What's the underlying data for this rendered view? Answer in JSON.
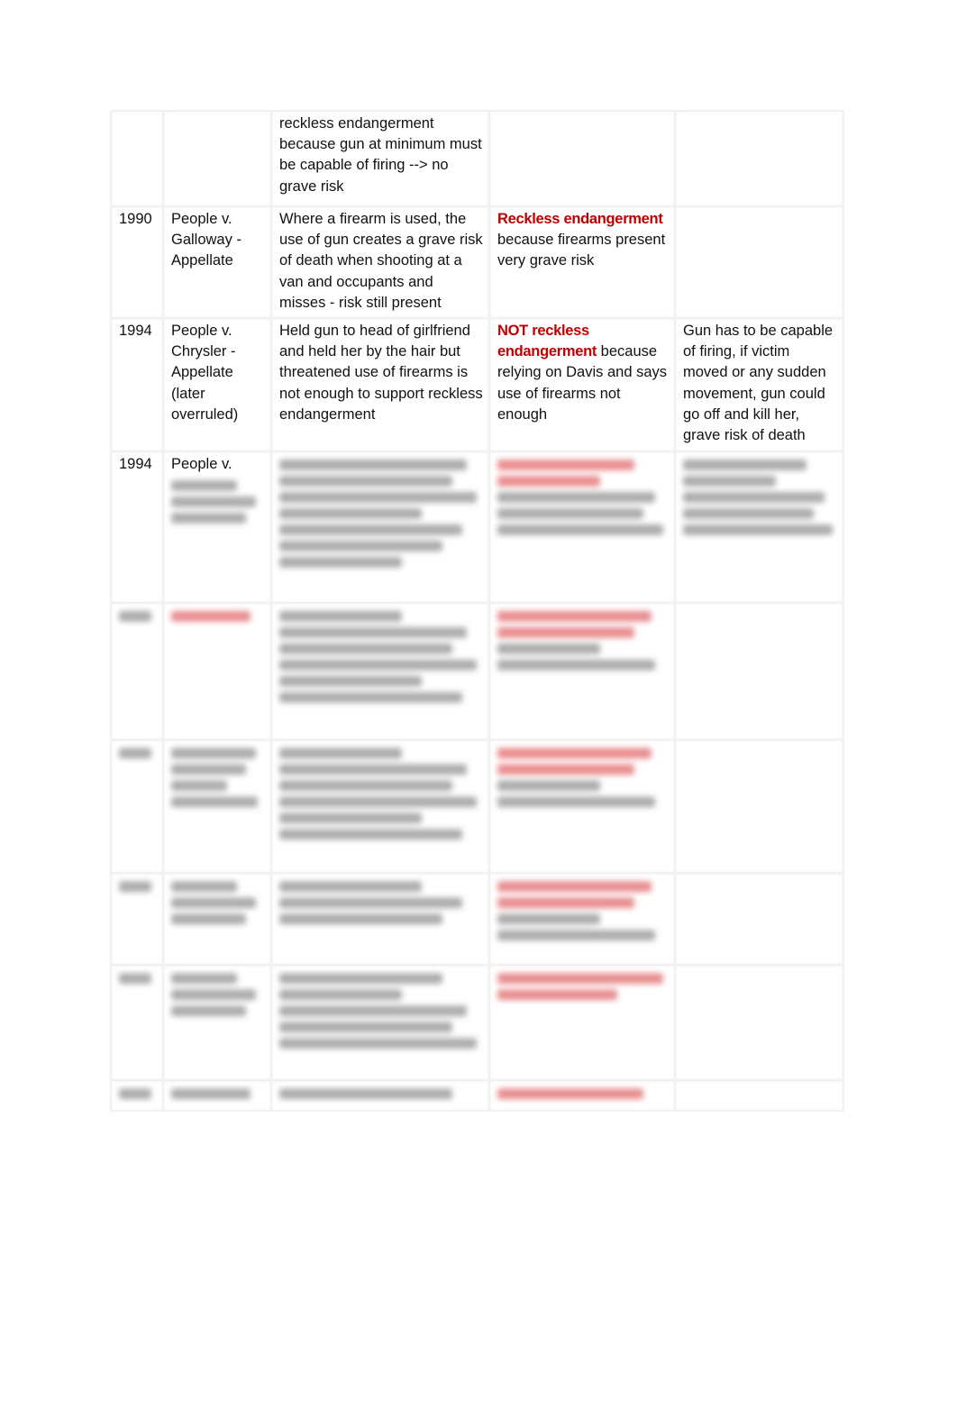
{
  "table": {
    "rows": [
      {
        "year": "",
        "case": "",
        "facts": "reckless endangerment because gun at minimum must be capable of firing --> no grave risk",
        "holding_red": "",
        "holding_rest": "",
        "notes": ""
      },
      {
        "year": "1990",
        "case": "People v. Galloway - Appellate",
        "facts": "Where a firearm is used, the use of gun creates a grave risk of death when shooting at a van and occupants and misses - risk still present",
        "holding_red": "Reckless endangerment",
        "holding_rest": " because firearms present very grave risk",
        "notes": ""
      },
      {
        "year": "1994",
        "case": "People v. Chrysler - Appellate (later overruled)",
        "facts": "Held gun to head of girlfriend and held her by the hair but threatened use of firearms is not enough to support reckless endangerment",
        "holding_red": "NOT reckless endangerment",
        "holding_rest": " because relying on Davis and says use of firearms not enough",
        "notes": "Gun has to be capable of firing, if victim moved or any sudden movement, gun could go off and kill her, grave risk of death"
      },
      {
        "year": "1994",
        "case": "People v."
      }
    ],
    "text_color": "#111111",
    "accent_red": "#c00000"
  }
}
